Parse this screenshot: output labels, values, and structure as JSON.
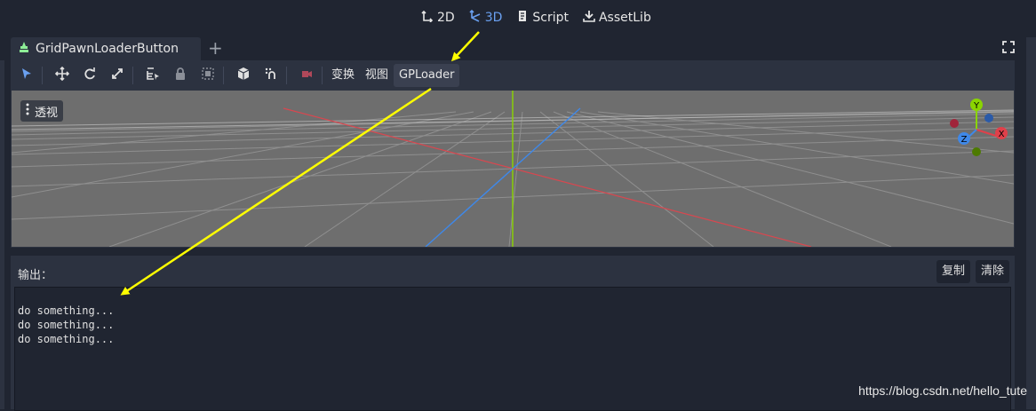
{
  "top_modes": [
    {
      "label": "2D",
      "icon": "2d-icon",
      "active": false
    },
    {
      "label": "3D",
      "icon": "3d-icon",
      "active": true
    },
    {
      "label": "Script",
      "icon": "script-icon",
      "active": false
    },
    {
      "label": "AssetLib",
      "icon": "assetlib-icon",
      "active": false
    }
  ],
  "scene_tab": {
    "label": "GridPawnLoaderButton",
    "icon": "node-icon"
  },
  "toolbar": {
    "menus": [
      "变换",
      "视图",
      "GPLoader"
    ]
  },
  "viewport": {
    "perspective_label": "透视",
    "gizmo_labels": {
      "x": "X",
      "y": "Y",
      "z": "Z"
    }
  },
  "output": {
    "title": "输出：",
    "copy_label": "复制",
    "clear_label": "清除",
    "lines": [
      "do something...",
      "do something...",
      "do something..."
    ]
  },
  "colors": {
    "accent": "#6aa0f0",
    "annotation": "#ffff00",
    "axis_x": "#e0404a",
    "axis_y": "#8ad400",
    "axis_z": "#3f88e8"
  },
  "watermark": "https://blog.csdn.net/hello_tute"
}
